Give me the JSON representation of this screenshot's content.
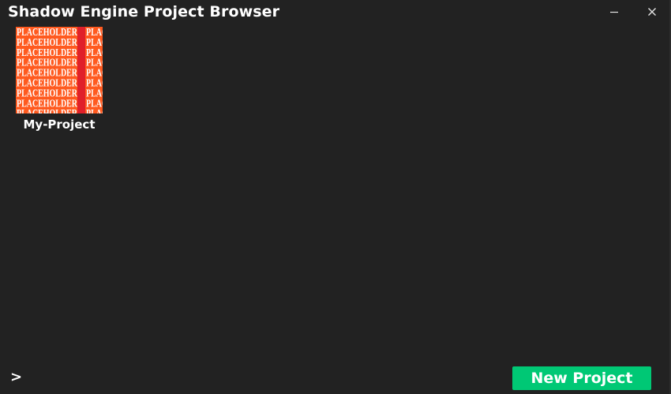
{
  "window": {
    "title": "Shadow Engine Project Browser",
    "controls": {
      "minimize_icon": "minimize-icon",
      "close_icon": "close-icon"
    }
  },
  "projects": [
    {
      "name": "My-Project",
      "thumbnail_text": "PLACEHOLDER",
      "thumbnail_colors": {
        "background": "#ff5a1f",
        "text": "#ffffff",
        "accent": "#e0202a"
      }
    }
  ],
  "footer": {
    "console_toggle": ">",
    "new_project_label": "New Project"
  },
  "colors": {
    "background": "#222222",
    "accent": "#00c875",
    "text": "#ffffff"
  }
}
